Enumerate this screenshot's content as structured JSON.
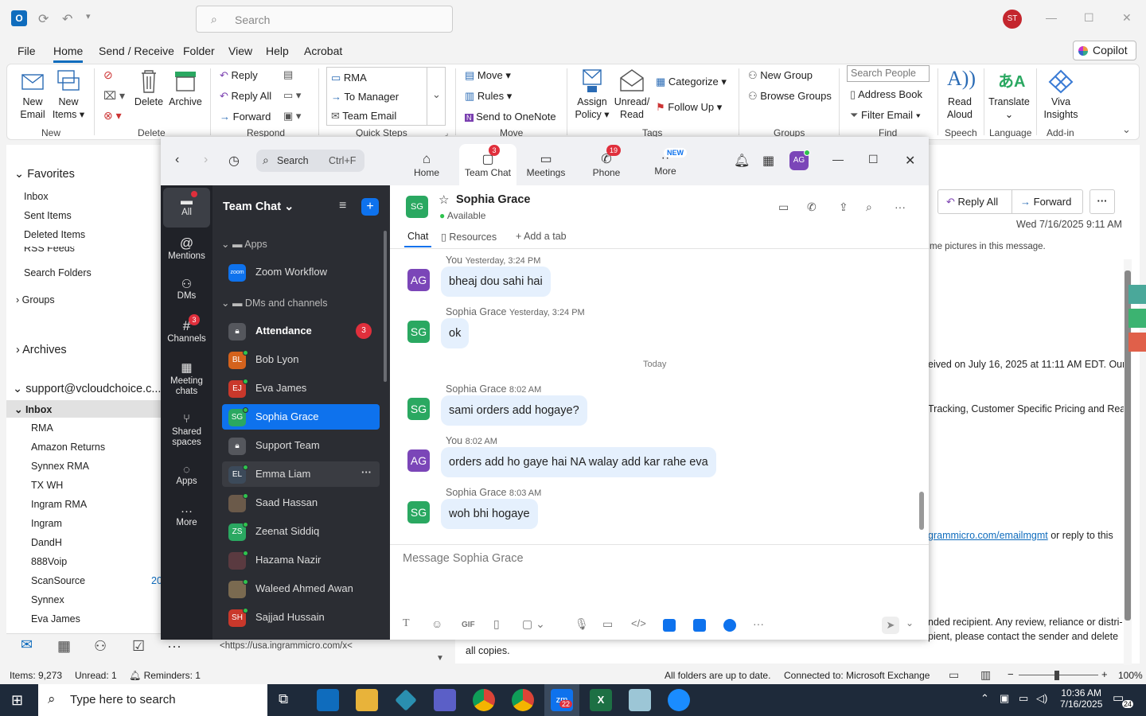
{
  "outlook": {
    "search_placeholder": "Search",
    "user_initials": "ST",
    "menu": [
      "File",
      "Home",
      "Send / Receive",
      "Folder",
      "View",
      "Help",
      "Acrobat"
    ],
    "copilot": "Copilot",
    "ribbon": {
      "new_email": [
        "New",
        "Email"
      ],
      "new_items": [
        "New",
        "Items"
      ],
      "delete": "Delete",
      "archive": "Archive",
      "reply": "Reply",
      "reply_all": "Reply All",
      "forward": "Forward",
      "qs_rma": "RMA",
      "qs_manager": "To Manager",
      "qs_team": "Team Email",
      "move": "Move",
      "rules": "Rules",
      "onenote": "Send to OneNote",
      "assign_policy": [
        "Assign",
        "Policy"
      ],
      "unread_read": [
        "Unread/",
        "Read"
      ],
      "categorize": "Categorize",
      "follow_up": "Follow Up",
      "new_group": "New Group",
      "browse_groups": "Browse Groups",
      "search_people": "Search People",
      "address_book": "Address Book",
      "filter_email": "Filter Email",
      "read_aloud": [
        "Read",
        "Aloud"
      ],
      "translate": "Translate",
      "viva": [
        "Viva",
        "Insights"
      ],
      "groups": [
        "New",
        "Delete",
        "Respond",
        "Quick Steps",
        "Move",
        "Tags",
        "Groups",
        "Find",
        "Speech",
        "Language",
        "Add-in"
      ]
    },
    "folders": {
      "favorites": "Favorites",
      "fav_items": [
        "Inbox",
        "Sent Items",
        "Deleted Items"
      ],
      "rss": "RSS Feeds",
      "search_folders": "Search Folders",
      "groups": "Groups",
      "archives": "Archives",
      "account": "support@vcloudchoice.c...",
      "inbox": "Inbox",
      "sub": [
        "RMA",
        "Amazon Returns",
        "Synnex RMA",
        "TX WH",
        "Ingram RMA",
        "Ingram",
        "DandH",
        "888Voip",
        "ScanSource",
        "Synnex",
        "Eva James"
      ],
      "scansource_count": "20"
    },
    "reading": {
      "reply_all": "Reply All",
      "forward": "Forward",
      "date": "Wed 7/16/2025 9:11 AM",
      "line1": "me pictures in this message.",
      "line2": "eived on July 16, 2025 at 11:11 AM EDT. Our",
      "line3": "Tracking, Customer Specific Pricing and Real-",
      "link": "grammicro.com/emailmgmt",
      "line4": " or reply to this",
      "line5": "nded recipient. Any review, reliance or distri-",
      "line6": "pient, please contact the sender and delete",
      "line7": "all copies.",
      "url": "<https://usa.ingrammicro.com/x<"
    },
    "status": {
      "items": "Items: 9,273",
      "unread": "Unread: 1",
      "reminders": "Reminders: 1",
      "folders": "All folders are up to date.",
      "connected": "Connected to: Microsoft Exchange",
      "zoom": "100%"
    }
  },
  "taskbar": {
    "search": "Type here to search",
    "time": "10:36 AM",
    "date": "7/16/2025",
    "notif": "24",
    "zoom_badge": "22"
  },
  "zoom": {
    "search": "Search",
    "shortcut": "Ctrl+F",
    "user_initials": "AG",
    "tabs": [
      {
        "label": "Home"
      },
      {
        "label": "Team Chat",
        "badge": "3"
      },
      {
        "label": "Meetings"
      },
      {
        "label": "Phone",
        "badge": "19"
      },
      {
        "label": "More",
        "badge": "NEW"
      }
    ],
    "nav": [
      {
        "label": "All"
      },
      {
        "label": "Mentions"
      },
      {
        "label": "DMs"
      },
      {
        "label": "Channels",
        "badge": "3"
      },
      {
        "label": "Meeting chats",
        "l1": "Meeting",
        "l2": "chats"
      },
      {
        "label": "Shared spaces",
        "l1": "Shared",
        "l2": "spaces"
      },
      {
        "label": "Apps"
      },
      {
        "label": "More"
      }
    ],
    "list_title": "Team Chat",
    "sec_apps": "Apps",
    "zoom_workflow": "Zoom Workflow",
    "sec_dms": "DMs and channels",
    "channels": [
      {
        "initials": "",
        "name": "Attendance",
        "badge": "3",
        "color": "#55575d"
      },
      {
        "initials": "BL",
        "name": "Bob Lyon",
        "color": "#d4621c"
      },
      {
        "initials": "EJ",
        "name": "Eva James",
        "color": "#c9382b"
      },
      {
        "initials": "SG",
        "name": "Sophia Grace",
        "color": "#2aa861"
      },
      {
        "initials": "",
        "name": "Support Team",
        "color": "#55575d"
      },
      {
        "initials": "EL",
        "name": "Emma Liam",
        "color": "#3c4a5a"
      },
      {
        "initials": "",
        "name": "Saad Hassan",
        "color": "#6b5a4a"
      },
      {
        "initials": "ZS",
        "name": "Zeenat Siddiq",
        "color": "#2aa861"
      },
      {
        "initials": "",
        "name": "Hazama Nazir",
        "color": "#5a3a40"
      },
      {
        "initials": "",
        "name": "Waleed Ahmed Awan",
        "color": "#7a6a50"
      },
      {
        "initials": "SH",
        "name": "Sajjad Hussain",
        "color": "#c9382b"
      }
    ],
    "chat": {
      "initials": "SG",
      "name": "Sophia Grace",
      "status": "Available",
      "tab_chat": "Chat",
      "tab_resources": "Resources",
      "tab_add": "Add a tab",
      "today": "Today",
      "placeholder": "Message Sophia Grace",
      "messages": [
        {
          "initials": "AG",
          "sender": "You",
          "time": "Yesterday, 3:24 PM",
          "text": "bheaj dou sahi hai"
        },
        {
          "initials": "SG",
          "sender": "Sophia Grace",
          "time": "Yesterday, 3:24 PM",
          "text": "ok"
        },
        {
          "initials": "SG",
          "sender": "Sophia Grace",
          "time": "8:02 AM",
          "text": "sami orders add hogaye?"
        },
        {
          "initials": "AG",
          "sender": "You",
          "time": "8:02 AM",
          "text": "orders add ho gaye hai NA walay add kar rahe eva"
        },
        {
          "initials": "SG",
          "sender": "Sophia Grace",
          "time": "8:03 AM",
          "text": "woh bhi hogaye"
        }
      ],
      "toolbar": [
        "T",
        "GIF"
      ]
    }
  },
  "colors": {
    "accent": "#0e72ed",
    "sg": "#2aa861",
    "ag": "#7b46b8"
  }
}
